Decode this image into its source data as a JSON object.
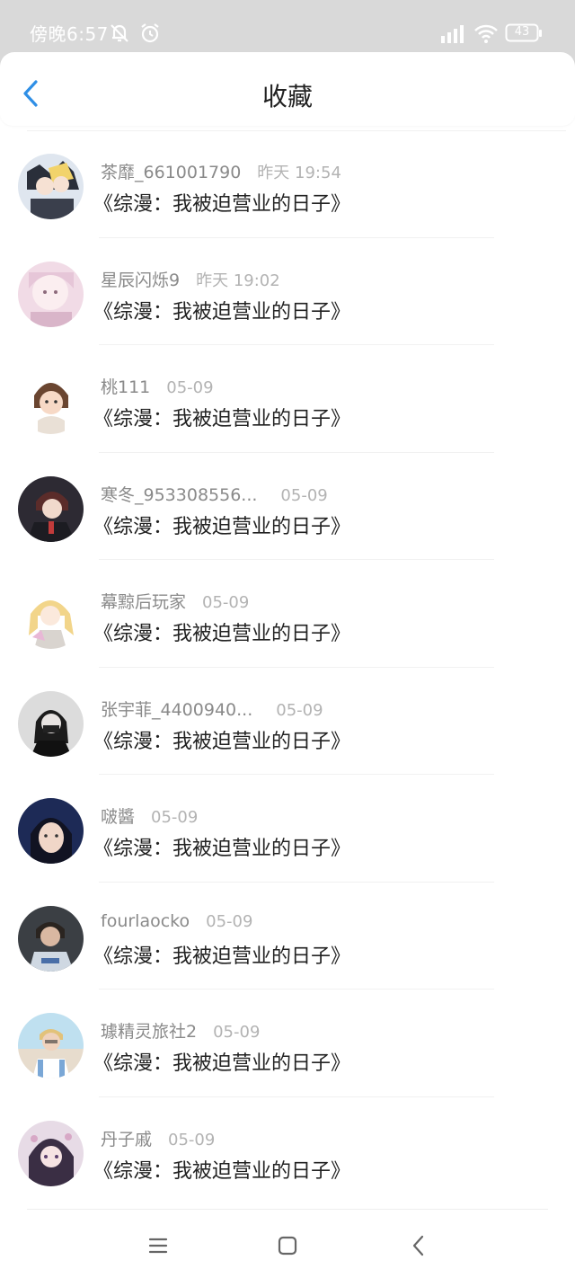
{
  "status": {
    "time": "傍晚6:57",
    "battery": "43"
  },
  "header": {
    "title": "收藏"
  },
  "items": [
    {
      "name": "茶靡_661001790",
      "time": "昨天 19:54",
      "title": "《综漫：我被迫营业的日子》"
    },
    {
      "name": "星辰闪烁9",
      "time": "昨天 19:02",
      "title": "《综漫：我被迫营业的日子》"
    },
    {
      "name": "桃111",
      "time": "05-09",
      "title": "《综漫：我被迫营业的日子》"
    },
    {
      "name": "寒冬_953308556...",
      "time": "05-09",
      "title": "《综漫：我被迫营业的日子》"
    },
    {
      "name": "幕黥后玩家",
      "time": "05-09",
      "title": "《综漫：我被迫营业的日子》"
    },
    {
      "name": "张宇菲_4400940...",
      "time": "05-09",
      "title": "《综漫：我被迫营业的日子》"
    },
    {
      "name": "啵醬",
      "time": "05-09",
      "title": "《综漫：我被迫营业的日子》"
    },
    {
      "name": "fourlaocko",
      "time": "05-09",
      "title": "《综漫：我被迫营业的日子》"
    },
    {
      "name": "璩精灵旅社2",
      "time": "05-09",
      "title": "《综漫：我被迫营业的日子》"
    },
    {
      "name": "丹子戚",
      "time": "05-09",
      "title": "《综漫：我被迫营业的日子》"
    }
  ],
  "colors": {
    "accent": "#2f8fe6",
    "status_bar_bg": "#d9d9d9"
  }
}
